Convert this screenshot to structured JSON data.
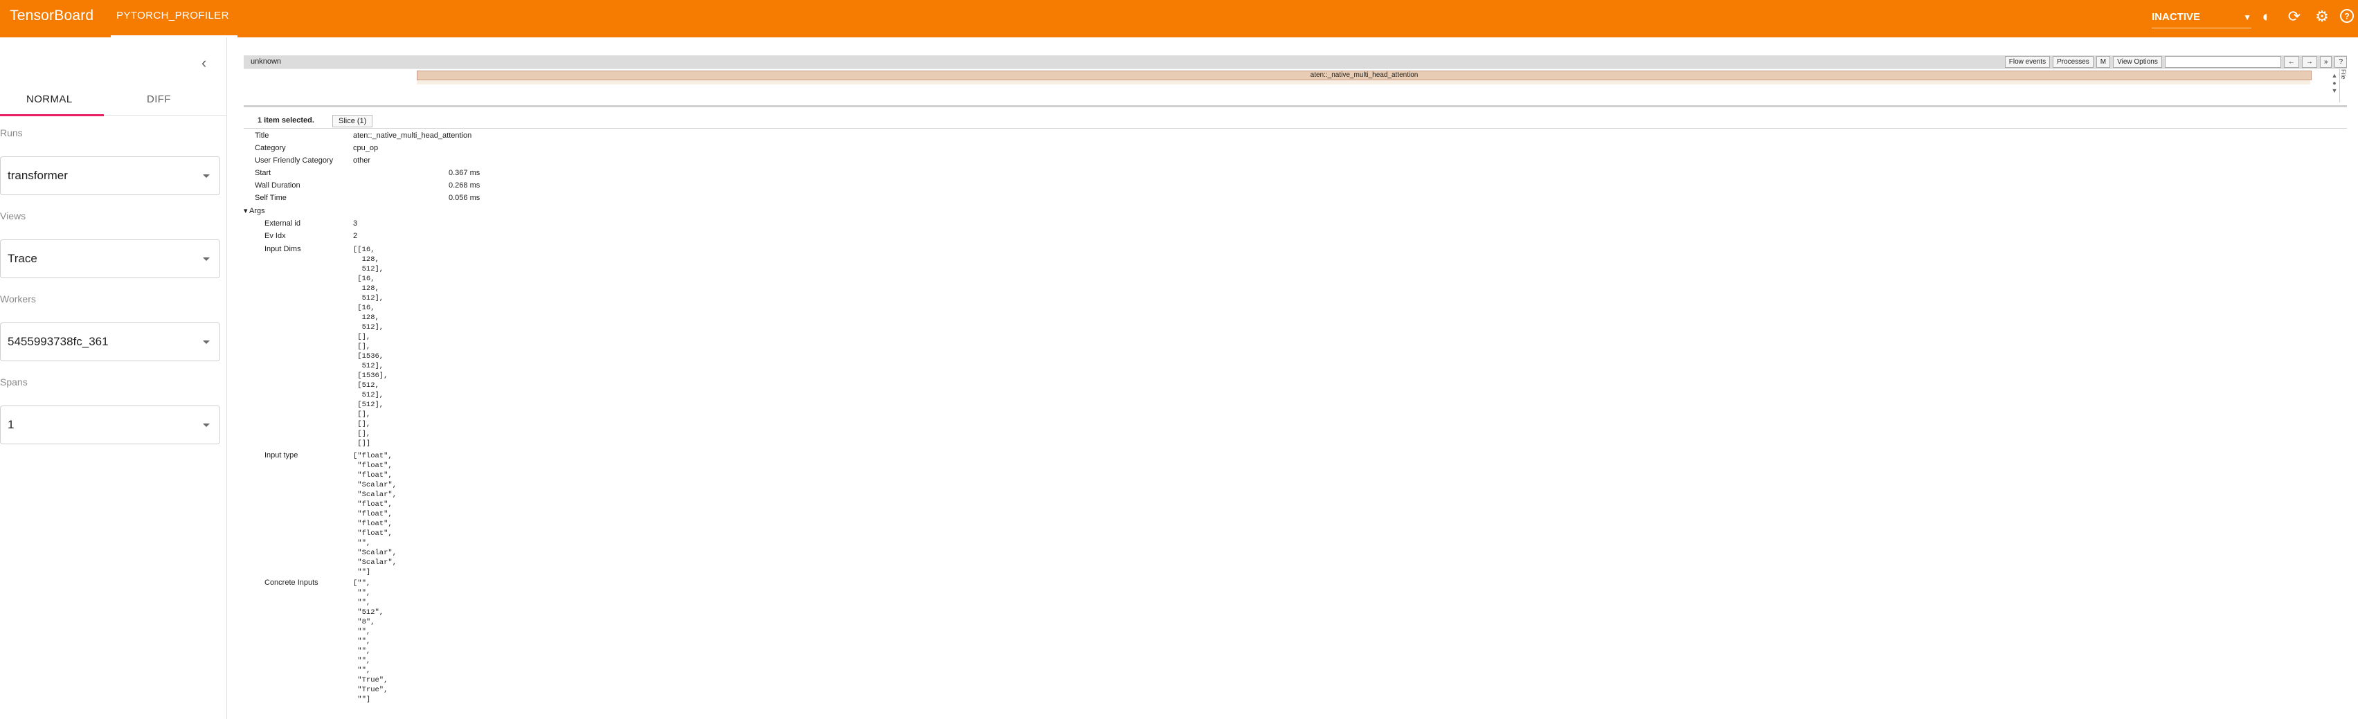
{
  "topbar": {
    "brand": "TensorBoard",
    "plugin_tab": "PYTORCH_PROFILER",
    "status": "INACTIVE"
  },
  "sidebar": {
    "tabs": [
      "NORMAL",
      "DIFF"
    ],
    "fields": [
      {
        "label": "Runs",
        "value": "transformer"
      },
      {
        "label": "Views",
        "value": "Trace"
      },
      {
        "label": "Workers",
        "value": "5455993738fc_361"
      },
      {
        "label": "Spans",
        "value": "1"
      }
    ]
  },
  "trace": {
    "process_label": "unknown",
    "buttons": [
      "Flow events",
      "Processes",
      "M",
      "View Options"
    ],
    "nav_buttons": [
      "←",
      "→",
      "»",
      "?"
    ],
    "slice_label": "aten::_native_multi_head_attention",
    "side_tab": "File"
  },
  "selection": {
    "summary": "1 item selected.",
    "tab": "Slice (1)",
    "title_label": "Title",
    "title_value": "aten::_native_multi_head_attention",
    "category_label": "Category",
    "category_value": "cpu_op",
    "ufc_label": "User Friendly Category",
    "ufc_value": "other",
    "start_label": "Start",
    "start_value": "0.367 ms",
    "wall_label": "Wall Duration",
    "wall_value": "0.268 ms",
    "self_label": "Self Time",
    "self_value": "0.056 ms",
    "args_label": "▾ Args",
    "ext_label": "External id",
    "ext_value": "3",
    "ev_label": "Ev Idx",
    "ev_value": "2",
    "dims_label": "Input Dims",
    "dims_value": "[[16,\n  128,\n  512],\n [16,\n  128,\n  512],\n [16,\n  128,\n  512],\n [],\n [],\n [1536,\n  512],\n [1536],\n [512,\n  512],\n [512],\n [],\n [],\n [],\n []]",
    "type_label": "Input type",
    "type_value": "[\"float\",\n \"float\",\n \"float\",\n \"Scalar\",\n \"Scalar\",\n \"float\",\n \"float\",\n \"float\",\n \"float\",\n \"\",\n \"Scalar\",\n \"Scalar\",\n \"\"]",
    "concrete_label": "Concrete Inputs",
    "concrete_value": "[\"\",\n \"\",\n \"\",\n \"512\",\n \"8\",\n \"\",\n \"\",\n \"\",\n \"\",\n \"\",\n \"True\",\n \"True\",\n \"\"]"
  }
}
